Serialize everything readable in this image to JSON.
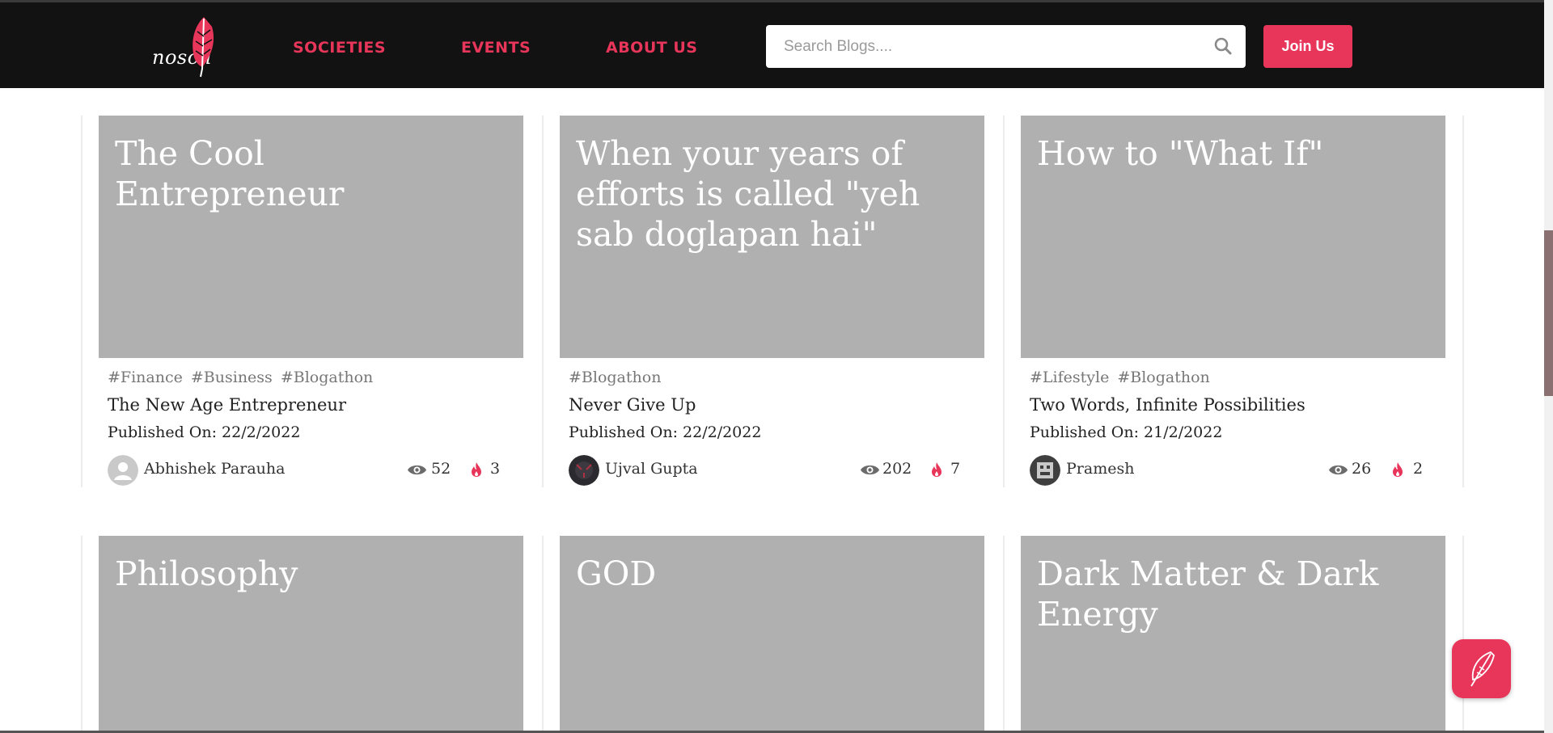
{
  "header": {
    "logo_text": "noscii",
    "nav": [
      {
        "label": "SOCIETIES"
      },
      {
        "label": "EVENTS"
      },
      {
        "label": "ABOUT US"
      }
    ],
    "search": {
      "placeholder": "Search Blogs...."
    },
    "join_label": "Join Us"
  },
  "colors": {
    "accent": "#e8355a",
    "header_bg": "#121212",
    "card_image_bg": "#b0b0b0"
  },
  "cards": [
    {
      "title": "The Cool Entrepreneur",
      "tags": [
        "#Finance",
        "#Business",
        "#Blogathon"
      ],
      "subtitle": "The New Age Entrepreneur",
      "published": "Published On: 22/2/2022",
      "author": "Abhishek Parauha",
      "avatar": "default-user-icon",
      "views": "52",
      "likes": "3"
    },
    {
      "title": "When your years of efforts is called \"yeh sab doglapan hai\"",
      "tags": [
        "#Blogathon"
      ],
      "subtitle": "Never Give Up",
      "published": "Published On: 22/2/2022",
      "author": "Ujval Gupta",
      "avatar": "photo-avatar",
      "views": "202",
      "likes": "7"
    },
    {
      "title": "How to \"What If\"",
      "tags": [
        "#Lifestyle",
        "#Blogathon"
      ],
      "subtitle": "Two Words, Infinite Possibilities",
      "published": "Published On: 21/2/2022",
      "author": "Pramesh",
      "avatar": "pixel-avatar",
      "views": "26",
      "likes": "2"
    },
    {
      "title": "Philosophy"
    },
    {
      "title": "GOD"
    },
    {
      "title": "Dark Matter & Dark Energy"
    }
  ],
  "fab": {
    "icon": "feather-pen-icon"
  }
}
